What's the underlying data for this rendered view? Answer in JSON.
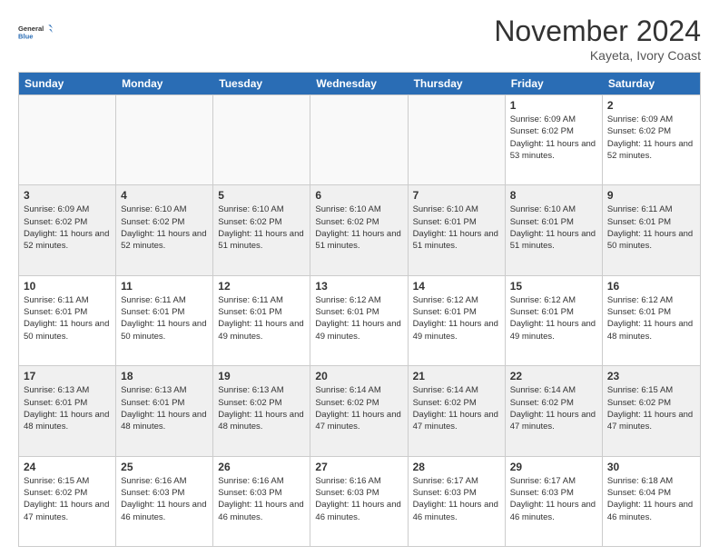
{
  "logo": {
    "general": "General",
    "blue": "Blue"
  },
  "header": {
    "month": "November 2024",
    "location": "Kayeta, Ivory Coast"
  },
  "days": [
    "Sunday",
    "Monday",
    "Tuesday",
    "Wednesday",
    "Thursday",
    "Friday",
    "Saturday"
  ],
  "weeks": [
    [
      {
        "day": "",
        "info": ""
      },
      {
        "day": "",
        "info": ""
      },
      {
        "day": "",
        "info": ""
      },
      {
        "day": "",
        "info": ""
      },
      {
        "day": "",
        "info": ""
      },
      {
        "day": "1",
        "info": "Sunrise: 6:09 AM\nSunset: 6:02 PM\nDaylight: 11 hours\nand 53 minutes."
      },
      {
        "day": "2",
        "info": "Sunrise: 6:09 AM\nSunset: 6:02 PM\nDaylight: 11 hours\nand 52 minutes."
      }
    ],
    [
      {
        "day": "3",
        "info": "Sunrise: 6:09 AM\nSunset: 6:02 PM\nDaylight: 11 hours\nand 52 minutes."
      },
      {
        "day": "4",
        "info": "Sunrise: 6:10 AM\nSunset: 6:02 PM\nDaylight: 11 hours\nand 52 minutes."
      },
      {
        "day": "5",
        "info": "Sunrise: 6:10 AM\nSunset: 6:02 PM\nDaylight: 11 hours\nand 51 minutes."
      },
      {
        "day": "6",
        "info": "Sunrise: 6:10 AM\nSunset: 6:02 PM\nDaylight: 11 hours\nand 51 minutes."
      },
      {
        "day": "7",
        "info": "Sunrise: 6:10 AM\nSunset: 6:01 PM\nDaylight: 11 hours\nand 51 minutes."
      },
      {
        "day": "8",
        "info": "Sunrise: 6:10 AM\nSunset: 6:01 PM\nDaylight: 11 hours\nand 51 minutes."
      },
      {
        "day": "9",
        "info": "Sunrise: 6:11 AM\nSunset: 6:01 PM\nDaylight: 11 hours\nand 50 minutes."
      }
    ],
    [
      {
        "day": "10",
        "info": "Sunrise: 6:11 AM\nSunset: 6:01 PM\nDaylight: 11 hours\nand 50 minutes."
      },
      {
        "day": "11",
        "info": "Sunrise: 6:11 AM\nSunset: 6:01 PM\nDaylight: 11 hours\nand 50 minutes."
      },
      {
        "day": "12",
        "info": "Sunrise: 6:11 AM\nSunset: 6:01 PM\nDaylight: 11 hours\nand 49 minutes."
      },
      {
        "day": "13",
        "info": "Sunrise: 6:12 AM\nSunset: 6:01 PM\nDaylight: 11 hours\nand 49 minutes."
      },
      {
        "day": "14",
        "info": "Sunrise: 6:12 AM\nSunset: 6:01 PM\nDaylight: 11 hours\nand 49 minutes."
      },
      {
        "day": "15",
        "info": "Sunrise: 6:12 AM\nSunset: 6:01 PM\nDaylight: 11 hours\nand 49 minutes."
      },
      {
        "day": "16",
        "info": "Sunrise: 6:12 AM\nSunset: 6:01 PM\nDaylight: 11 hours\nand 48 minutes."
      }
    ],
    [
      {
        "day": "17",
        "info": "Sunrise: 6:13 AM\nSunset: 6:01 PM\nDaylight: 11 hours\nand 48 minutes."
      },
      {
        "day": "18",
        "info": "Sunrise: 6:13 AM\nSunset: 6:01 PM\nDaylight: 11 hours\nand 48 minutes."
      },
      {
        "day": "19",
        "info": "Sunrise: 6:13 AM\nSunset: 6:02 PM\nDaylight: 11 hours\nand 48 minutes."
      },
      {
        "day": "20",
        "info": "Sunrise: 6:14 AM\nSunset: 6:02 PM\nDaylight: 11 hours\nand 47 minutes."
      },
      {
        "day": "21",
        "info": "Sunrise: 6:14 AM\nSunset: 6:02 PM\nDaylight: 11 hours\nand 47 minutes."
      },
      {
        "day": "22",
        "info": "Sunrise: 6:14 AM\nSunset: 6:02 PM\nDaylight: 11 hours\nand 47 minutes."
      },
      {
        "day": "23",
        "info": "Sunrise: 6:15 AM\nSunset: 6:02 PM\nDaylight: 11 hours\nand 47 minutes."
      }
    ],
    [
      {
        "day": "24",
        "info": "Sunrise: 6:15 AM\nSunset: 6:02 PM\nDaylight: 11 hours\nand 47 minutes."
      },
      {
        "day": "25",
        "info": "Sunrise: 6:16 AM\nSunset: 6:03 PM\nDaylight: 11 hours\nand 46 minutes."
      },
      {
        "day": "26",
        "info": "Sunrise: 6:16 AM\nSunset: 6:03 PM\nDaylight: 11 hours\nand 46 minutes."
      },
      {
        "day": "27",
        "info": "Sunrise: 6:16 AM\nSunset: 6:03 PM\nDaylight: 11 hours\nand 46 minutes."
      },
      {
        "day": "28",
        "info": "Sunrise: 6:17 AM\nSunset: 6:03 PM\nDaylight: 11 hours\nand 46 minutes."
      },
      {
        "day": "29",
        "info": "Sunrise: 6:17 AM\nSunset: 6:03 PM\nDaylight: 11 hours\nand 46 minutes."
      },
      {
        "day": "30",
        "info": "Sunrise: 6:18 AM\nSunset: 6:04 PM\nDaylight: 11 hours\nand 46 minutes."
      }
    ]
  ],
  "shaded_rows": [
    1,
    3
  ]
}
